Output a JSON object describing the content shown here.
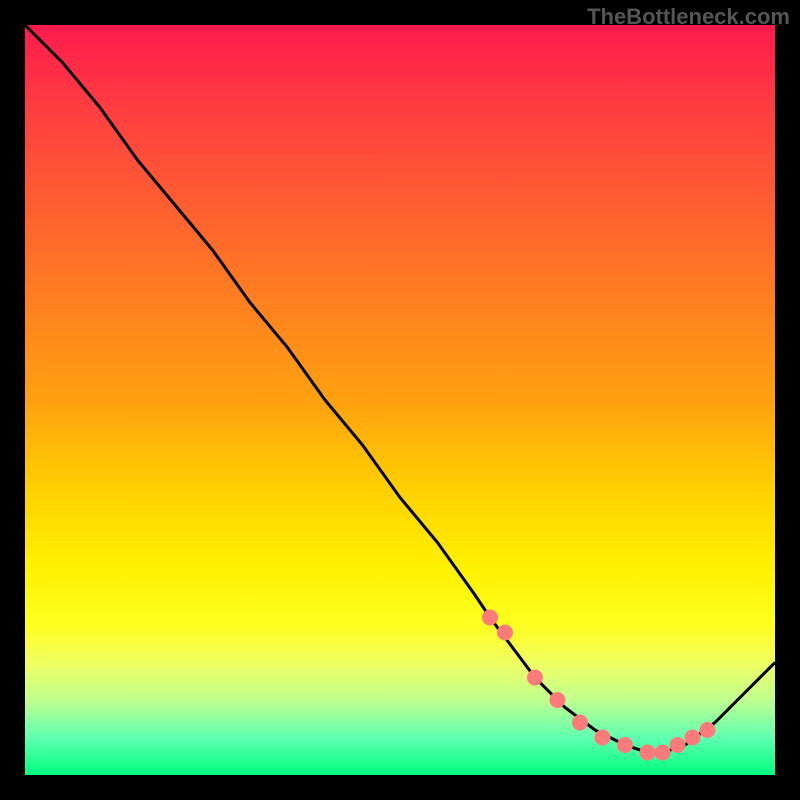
{
  "attribution": "TheBottleneck.com",
  "chart_data": {
    "type": "line",
    "title": "",
    "xlabel": "",
    "ylabel": "",
    "xlim": [
      0,
      100
    ],
    "ylim": [
      0,
      100
    ],
    "background": "rainbow-vertical-gradient",
    "series": [
      {
        "name": "bottleneck-curve",
        "x": [
          0,
          5,
          10,
          15,
          20,
          25,
          30,
          35,
          40,
          45,
          50,
          55,
          60,
          62,
          65,
          68,
          72,
          76,
          80,
          83,
          85,
          88,
          92,
          96,
          100
        ],
        "y": [
          100,
          95,
          89,
          82,
          76,
          70,
          63,
          57,
          50,
          44,
          37,
          31,
          24,
          21,
          17,
          13,
          9,
          6,
          4,
          3,
          3,
          4,
          7,
          11,
          15
        ]
      }
    ],
    "markers": {
      "name": "optimal-range-dots",
      "x": [
        62,
        64,
        68,
        71,
        74,
        77,
        80,
        83,
        85,
        87,
        89,
        91
      ],
      "y": [
        21,
        19,
        13,
        10,
        7,
        5,
        4,
        3,
        3,
        4,
        5,
        6
      ]
    }
  }
}
